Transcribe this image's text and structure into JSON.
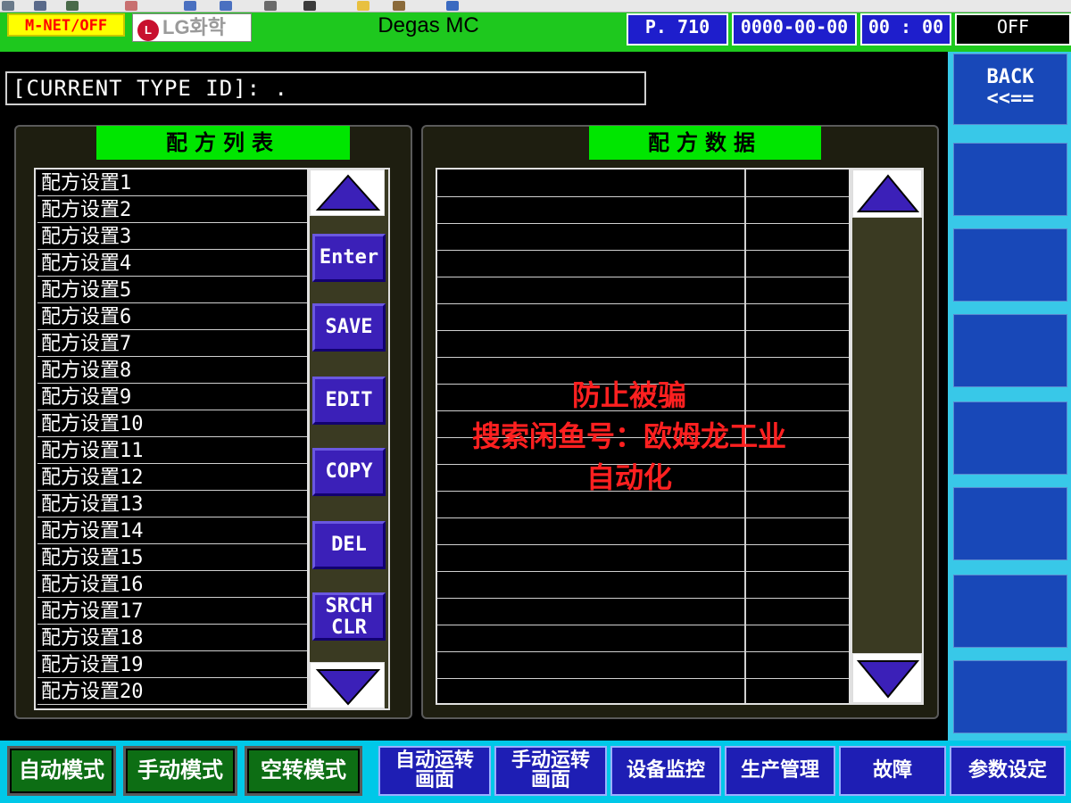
{
  "header": {
    "mnet_status": "M-NET/OFF",
    "logo_text": "LG화학",
    "logo_mark": "L",
    "app_title": "Degas MC",
    "page": "P. 710",
    "date": "0000-00-00",
    "time": "00 : 00",
    "power_status": "OFF"
  },
  "type_id": "[CURRENT TYPE ID]:  .",
  "recipe_list": {
    "title": "配方列表",
    "items": [
      "配方设置1",
      "配方设置2",
      "配方设置3",
      "配方设置4",
      "配方设置5",
      "配方设置6",
      "配方设置7",
      "配方设置8",
      "配方设置9",
      "配方设置10",
      "配方设置11",
      "配方设置12",
      "配方设置13",
      "配方设置14",
      "配方设置15",
      "配方设置16",
      "配方设置17",
      "配方设置18",
      "配方设置19",
      "配方设置20"
    ],
    "buttons": {
      "enter": "Enter",
      "save": "SAVE",
      "edit": "EDIT",
      "copy": "COPY",
      "del": "DEL",
      "srch1": "SRCH",
      "srch2": "CLR"
    }
  },
  "recipe_data": {
    "title": "配方数据"
  },
  "watermark": {
    "line1": "防止被骗",
    "line2": "搜索闲鱼号：欧姆龙工业",
    "line3": "自动化"
  },
  "side": {
    "back_line1": "BACK",
    "back_line2": "<<=="
  },
  "bottom": {
    "auto_mode": "自动模式",
    "manual_mode": "手动模式",
    "dry_mode": "空转模式",
    "auto_run_1": "自动运转",
    "auto_run_2": "画面",
    "manual_run_1": "手动运转",
    "manual_run_2": "画面",
    "monitor": "设备监控",
    "production": "生产管理",
    "fault": "故障",
    "params": "参数设定"
  },
  "colors": {
    "header_green": "#1ec81e",
    "title_green": "#00e600",
    "button_purple": "#3b20b8",
    "accent_cyan": "#38c8e8",
    "warning_red": "#ff2020"
  }
}
